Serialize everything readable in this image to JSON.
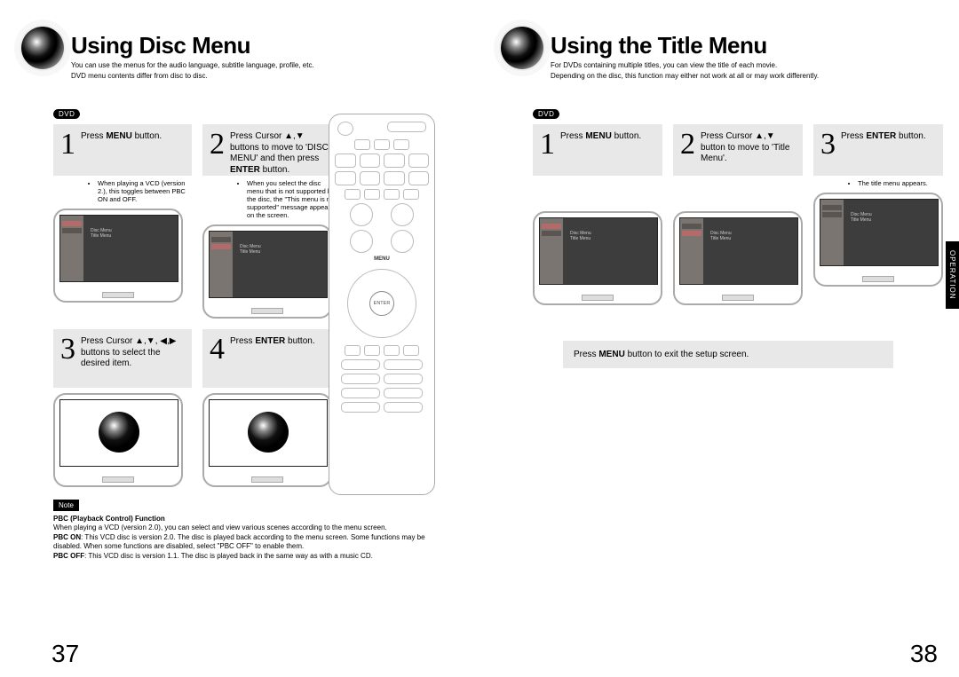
{
  "left": {
    "title": "Using Disc Menu",
    "intro1": "You can use the menus for the audio language, subtitle language, profile, etc.",
    "intro2": "DVD menu contents differ from disc to disc.",
    "dvd_badge": "DVD",
    "step1": {
      "num": "1",
      "text_pre": "Press ",
      "b1": "MENU",
      "text_post": " button."
    },
    "step1_note": "When playing a VCD (version 2.), this toggles between PBC ON and OFF.",
    "step2": {
      "num": "2",
      "line": "Press Cursor ▲,▼ buttons to move to 'DISC MENU' and then press ",
      "b": "ENTER",
      "post": " button."
    },
    "step2_note": "When you select the disc menu that is not supported by the disc, the \"This menu is not supported\" message appears on the screen.",
    "step3": {
      "num": "3",
      "line": "Press Cursor ▲,▼, ◀,▶ buttons to select the desired item."
    },
    "step4": {
      "num": "4",
      "text_pre": "Press ",
      "b1": "ENTER",
      "text_post": " button."
    },
    "note_label": "Note",
    "pbc_title": "PBC (Playback Control) Function",
    "pbc_intro": "When playing a VCD (version 2.0), you can select and view various scenes according to the menu screen.",
    "pbc_on_label": "PBC ON",
    "pbc_on": ": This VCD disc is version 2.0. The disc is played back according to the menu screen. Some functions may be disabled. When some functions are disabled, select \"PBC OFF\" to enable them.",
    "pbc_off_label": "PBC OFF",
    "pbc_off": ": This VCD disc is version 1.1. The disc is played back in the same way as with a music CD.",
    "screen_text": "Disc Menu\nTitle Menu",
    "page_num": "37"
  },
  "right": {
    "title": "Using the Title Menu",
    "intro1": "For DVDs containing multiple titles, you can view the title of each movie.",
    "intro2": "Depending on the disc, this function may either not work at all or may work differently.",
    "dvd_badge": "DVD",
    "step1": {
      "num": "1",
      "text_pre": "Press ",
      "b1": "MENU",
      "text_post": " button."
    },
    "step2": {
      "num": "2",
      "line": "Press Cursor ▲,▼ button to move to 'Title Menu'."
    },
    "step3": {
      "num": "3",
      "text_pre": "Press ",
      "b1": "ENTER",
      "text_post": " button."
    },
    "step3_note": "The title menu appears.",
    "screen_text": "Disc Menu\nTitle Menu",
    "exit": {
      "pre": "Press ",
      "b": "MENU",
      "post": " button to exit the setup screen."
    },
    "sidetab": "OPERATION",
    "page_num": "38"
  },
  "remote": {
    "enter": "ENTER"
  }
}
